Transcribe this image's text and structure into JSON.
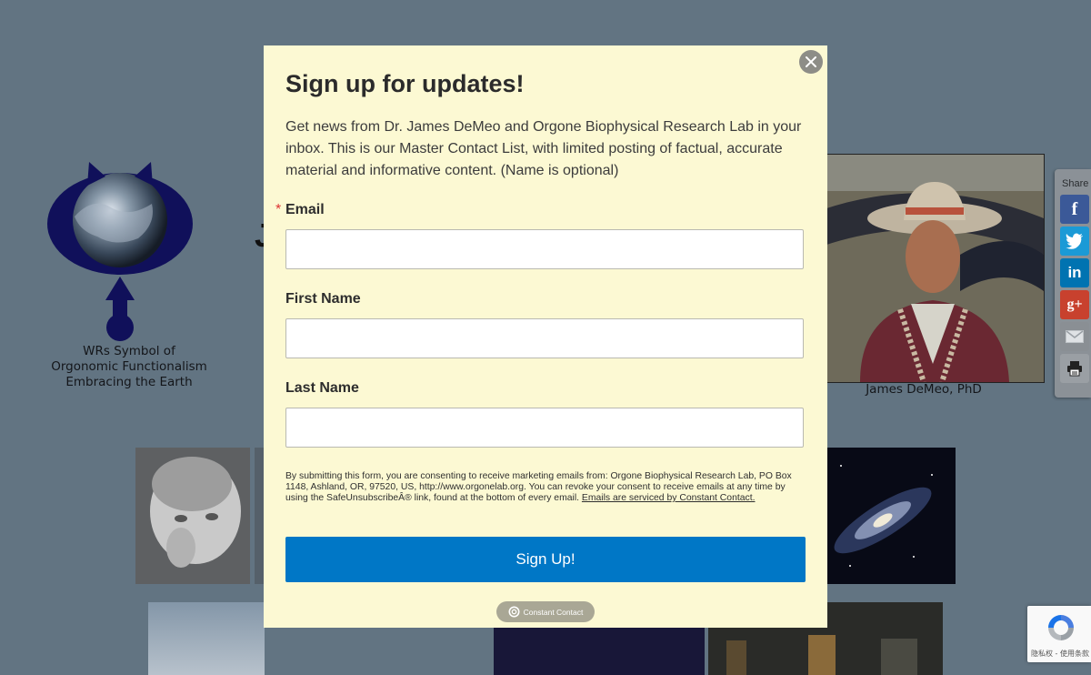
{
  "background": {
    "logo_caption": [
      "WRs Symbol of",
      "Orgonomic Functionalism",
      "Embracing the Earth"
    ],
    "heading_fragment": "J",
    "portrait_caption": "James DeMeo, PhD"
  },
  "share": {
    "label": "Share",
    "buttons": [
      {
        "name": "facebook",
        "icon": "facebook-icon",
        "color": "#3b5998"
      },
      {
        "name": "twitter",
        "icon": "twitter-icon",
        "color": "#1b9ad6"
      },
      {
        "name": "linkedin",
        "icon": "linkedin-icon",
        "color": "#0073b1"
      },
      {
        "name": "google-plus",
        "icon": "google-plus-icon",
        "color": "#c8412e"
      },
      {
        "name": "email",
        "icon": "mail-icon",
        "color": "#8a8f94"
      },
      {
        "name": "print",
        "icon": "printer-icon",
        "color": "#9a9fa4"
      }
    ]
  },
  "modal": {
    "title": "Sign up for updates!",
    "intro": "Get news from Dr. James DeMeo and Orgone Biophysical Research Lab in your inbox. This is our Master Contact List, with limited posting of factual, accurate material and informative content.  (Name is optional)",
    "required_mark": "*",
    "fields": {
      "email": {
        "label": "Email",
        "value": "",
        "placeholder": ""
      },
      "first_name": {
        "label": "First Name",
        "value": "",
        "placeholder": ""
      },
      "last_name": {
        "label": "Last Name",
        "value": "",
        "placeholder": ""
      }
    },
    "legal_text": "By submitting this form, you are consenting to receive marketing emails from: Orgone Biophysical Research Lab, PO Box 1148, Ashland, OR, 97520, US, http://www.orgonelab.org. You can revoke your consent to receive emails at any time by using the SafeUnsubscribeÂ® link, found at the bottom of every email. ",
    "legal_link": "Emails are serviced by Constant Contact.",
    "submit_label": "Sign Up!",
    "badge_label": "Constant Contact",
    "colors": {
      "background": "#fcf9d3",
      "button": "#0077c6"
    }
  },
  "recaptcha": {
    "text": "隐私权 - 使用条款"
  }
}
